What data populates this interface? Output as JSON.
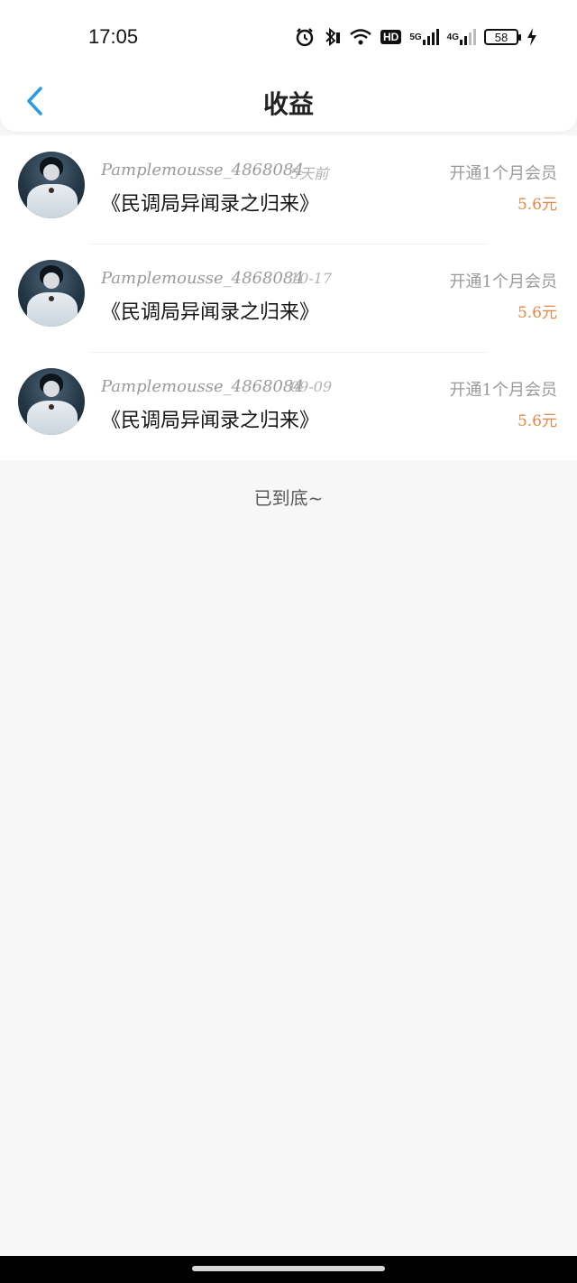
{
  "status_bar": {
    "time": "17:05",
    "icons": [
      "alarm-icon",
      "bluetooth-icon",
      "wifi-icon",
      "hd-icon",
      "signal-5g-icon",
      "signal-4g-icon"
    ],
    "hd_label": "HD",
    "net1_label": "5G",
    "net2_label": "4G",
    "battery": "58"
  },
  "nav": {
    "back_icon": "chevron-left-icon",
    "title": "收益",
    "accent_color": "#2c9be0"
  },
  "items": [
    {
      "username": "Pamplemousse_4868084",
      "time": "5天前",
      "book": "《民调局异闻录之归来》",
      "desc": "开通1个月会员",
      "amount": "5.6元"
    },
    {
      "username": "Pamplemousse_4868084",
      "time": "10-17",
      "book": "《民调局异闻录之归来》",
      "desc": "开通1个月会员",
      "amount": "5.6元"
    },
    {
      "username": "Pamplemousse_4868084",
      "time": "09-09",
      "book": "《民调局异闻录之归来》",
      "desc": "开通1个月会员",
      "amount": "5.6元"
    }
  ],
  "footer": {
    "end_text": "已到底~"
  },
  "colors": {
    "amount": "#e3884a",
    "background": "#f8f7f8"
  }
}
